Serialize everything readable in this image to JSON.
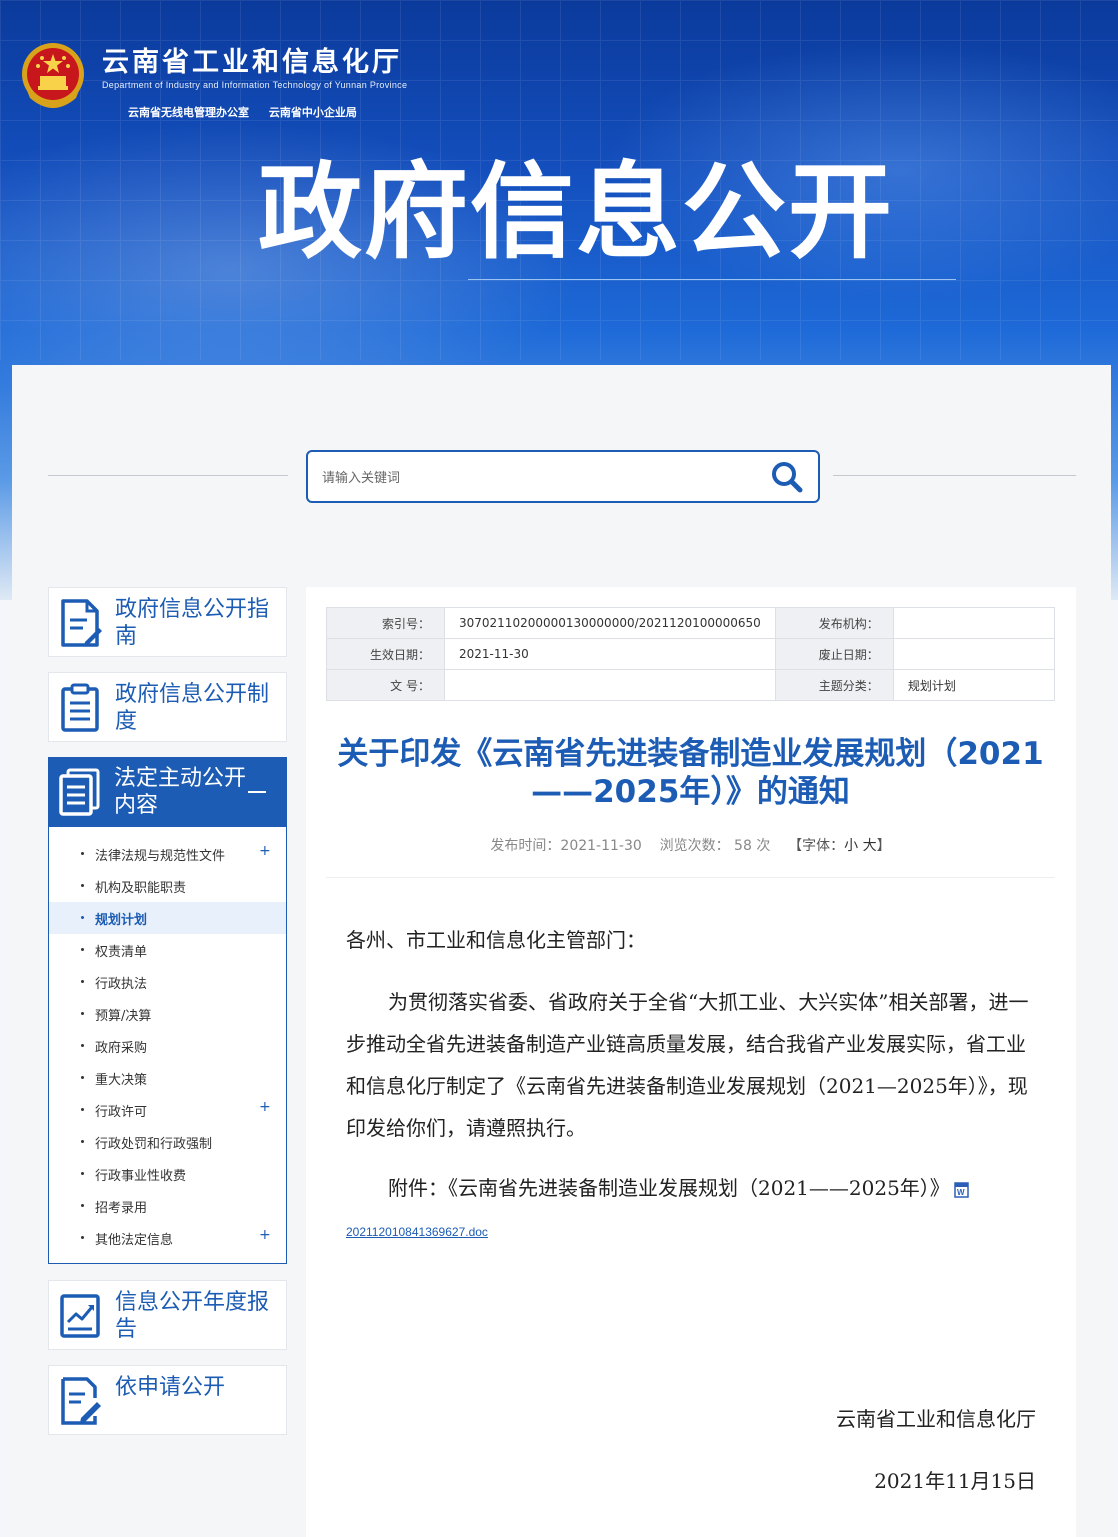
{
  "header": {
    "site_title": "云南省工业和信息化厅",
    "site_subtitle": "Department of Industry and Information Technology of Yunnan Province",
    "links": [
      "云南省无线电管理办公室",
      "云南省中小企业局"
    ],
    "big_title": "政府信息公开"
  },
  "search": {
    "placeholder": "请输入关键词"
  },
  "sidebar": {
    "cards": [
      {
        "label": "政府信息公开指南",
        "icon": "guide-doc-icon"
      },
      {
        "label": "政府信息公开制度",
        "icon": "list-doc-icon"
      },
      {
        "label": "法定主动公开内容",
        "icon": "docs-stack-icon"
      },
      {
        "label": "信息公开年度报告",
        "icon": "chart-report-icon"
      },
      {
        "label": "依申请公开",
        "icon": "edit-doc-icon"
      }
    ],
    "submenu": [
      {
        "label": "法律法规与规范性文件",
        "expandable": true
      },
      {
        "label": "机构及职能职责",
        "expandable": false
      },
      {
        "label": "规划计划",
        "expandable": false,
        "active": true
      },
      {
        "label": "权责清单",
        "expandable": false
      },
      {
        "label": "行政执法",
        "expandable": false
      },
      {
        "label": "预算/决算",
        "expandable": false
      },
      {
        "label": "政府采购",
        "expandable": false
      },
      {
        "label": "重大决策",
        "expandable": false
      },
      {
        "label": "行政许可",
        "expandable": true
      },
      {
        "label": "行政处罚和行政强制",
        "expandable": false
      },
      {
        "label": "行政事业性收费",
        "expandable": false
      },
      {
        "label": "招考录用",
        "expandable": false
      },
      {
        "label": "其他法定信息",
        "expandable": true
      }
    ],
    "plus_glyph": "+"
  },
  "meta": {
    "index_no_label": "索引号：",
    "index_no": "30702110200000130000000/2021120100000650",
    "publisher_label": "发布机构：",
    "publisher": "",
    "effective_label": "生效日期：",
    "effective": "2021-11-30",
    "expire_label": "废止日期：",
    "expire": "",
    "docno_label": "文 号：",
    "docno": "",
    "topic_label": "主题分类：",
    "topic": "规划计划"
  },
  "article": {
    "title_line1": "关于印发《云南省先进装备制造业发展规划（2021",
    "title_line2": "——2025年）》的通知",
    "publish_label": "发布时间：",
    "publish_time": "2021-11-30",
    "views_label": "浏览次数：",
    "views": "58",
    "views_unit": "次",
    "font_label_open": "【字体：",
    "font_small": "小",
    "font_large": "大",
    "font_label_close": "】",
    "greeting": "各州、市工业和信息化主管部门：",
    "paragraph": "为贯彻落实省委、省政府关于全省“大抓工业、大兴实体”相关部署，进一步推动全省先进装备制造产业链高质量发展，结合我省产业发展实际，省工业和信息化厅制定了《云南省先进装备制造业发展规划（2021—2025年）》，现印发给你们，请遵照执行。",
    "attachment_text": "附件：《云南省先进装备制造业发展规划（2021——2025年）》",
    "attachment_file": "202112010841369627.doc",
    "signature_org": "云南省工业和信息化厅",
    "signature_date": "2021年11月15日"
  },
  "colors": {
    "brand_blue": "#1c5cb4",
    "banner_dark": "#0b3a9c"
  }
}
